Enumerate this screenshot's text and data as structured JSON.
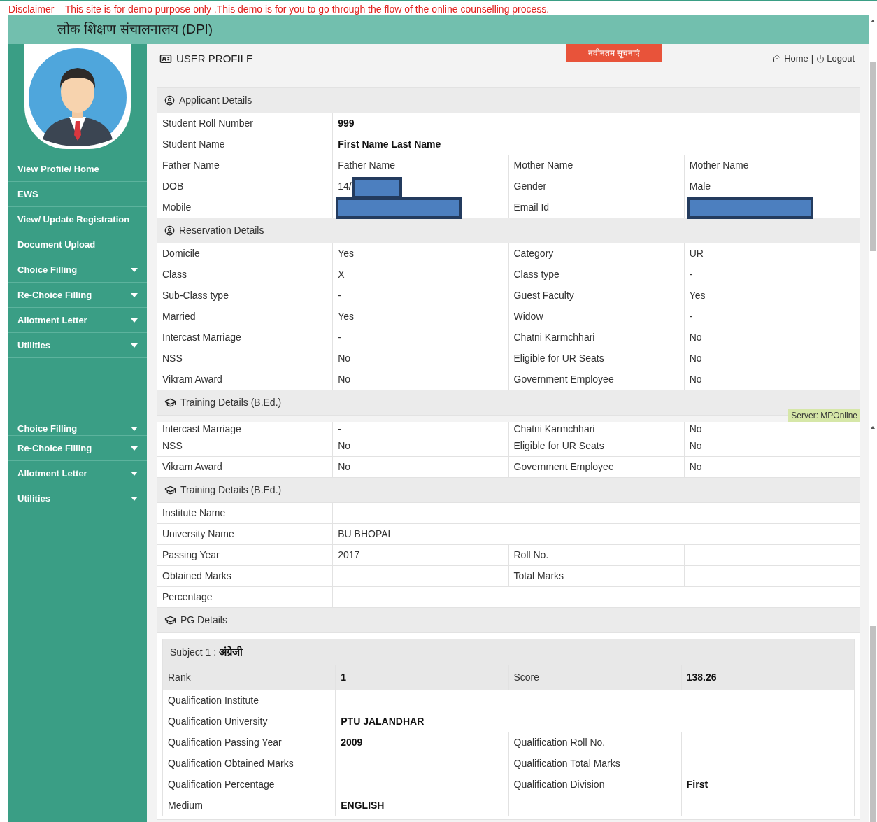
{
  "disclaimer": "Disclaimer – This site is for demo purpose only .This demo is for you to go through the flow of the online counselling process.",
  "header": {
    "title": "लोक शिक्षण संचालनालय (DPI)"
  },
  "top_view": {
    "sidebar_items": [
      {
        "label": "View Profile/ Home",
        "dropdown": false
      },
      {
        "label": "EWS",
        "dropdown": false
      },
      {
        "label": "View/ Update Registration",
        "dropdown": false
      },
      {
        "label": "Document Upload",
        "dropdown": false
      },
      {
        "label": "Choice Filling",
        "dropdown": true
      },
      {
        "label": "Re-Choice Filling",
        "dropdown": true
      },
      {
        "label": "Allotment Letter",
        "dropdown": true
      },
      {
        "label": "Utilities",
        "dropdown": true
      }
    ],
    "page_title": "USER PROFILE",
    "notice_button": "नवीनतम सूचनाएं",
    "nav": {
      "home": "Home",
      "separator": "|",
      "logout": "Logout"
    },
    "sections": [
      {
        "title": "Applicant Details",
        "kind": "user",
        "rows": [
          {
            "cells": [
              {
                "text": "Student Roll Number"
              },
              {
                "text": "999",
                "bold": true,
                "wide": true
              }
            ]
          },
          {
            "cells": [
              {
                "text": "Student Name"
              },
              {
                "text": "First Name Last Name",
                "bold": true,
                "wide": true
              }
            ]
          },
          {
            "cells": [
              {
                "text": "Father Name"
              },
              {
                "text": "Father Name"
              },
              {
                "text": "Mother Name"
              },
              {
                "text": "Mother Name"
              }
            ]
          },
          {
            "cells": [
              {
                "text": "DOB"
              },
              {
                "text": "14/",
                "redacted": true
              },
              {
                "text": "Gender"
              },
              {
                "text": "Male"
              }
            ]
          },
          {
            "cells": [
              {
                "text": "Mobile"
              },
              {
                "redacted": true
              },
              {
                "text": "Email Id"
              },
              {
                "redacted": true
              }
            ]
          }
        ]
      },
      {
        "title": "Reservation Details",
        "kind": "user",
        "rows": [
          {
            "cells": [
              {
                "text": "Domicile"
              },
              {
                "text": "Yes"
              },
              {
                "text": "Category"
              },
              {
                "text": "UR"
              }
            ]
          },
          {
            "cells": [
              {
                "text": "Class"
              },
              {
                "text": "X"
              },
              {
                "text": "Class type"
              },
              {
                "text": "-"
              }
            ]
          },
          {
            "cells": [
              {
                "text": "Sub-Class type"
              },
              {
                "text": "-"
              },
              {
                "text": "Guest Faculty"
              },
              {
                "text": "Yes"
              }
            ]
          },
          {
            "cells": [
              {
                "text": "Married"
              },
              {
                "text": "Yes"
              },
              {
                "text": "Widow"
              },
              {
                "text": "-"
              }
            ]
          },
          {
            "cells": [
              {
                "text": "Intercast Marriage"
              },
              {
                "text": "-"
              },
              {
                "text": "Chatni Karmchhari"
              },
              {
                "text": "No"
              }
            ]
          },
          {
            "cells": [
              {
                "text": "NSS"
              },
              {
                "text": "No"
              },
              {
                "text": "Eligible for UR Seats"
              },
              {
                "text": "No"
              }
            ]
          },
          {
            "cells": [
              {
                "text": "Vikram Award"
              },
              {
                "text": "No"
              },
              {
                "text": "Government Employee"
              },
              {
                "text": "No"
              }
            ]
          }
        ]
      },
      {
        "title": "Training Details (B.Ed.)",
        "kind": "cap"
      }
    ],
    "server_label": "Server: MPOnline"
  },
  "bottom_view": {
    "sidebar_items": [
      {
        "label": "Choice Filling",
        "dropdown": true,
        "clipped": true
      },
      {
        "label": "Re-Choice Filling",
        "dropdown": true,
        "clipped": false
      },
      {
        "label": "Allotment Letter",
        "dropdown": true,
        "clipped": false
      },
      {
        "label": "Utilities",
        "dropdown": true,
        "clipped": false
      }
    ],
    "sections": [
      {
        "rows": [
          {
            "clipped": true,
            "cells": [
              {
                "text": "Intercast Marriage"
              },
              {
                "text": "-"
              },
              {
                "text": "Chatni Karmchhari"
              },
              {
                "text": "No"
              }
            ]
          },
          {
            "cells": [
              {
                "text": "NSS"
              },
              {
                "text": "No"
              },
              {
                "text": "Eligible for UR Seats"
              },
              {
                "text": "No"
              }
            ]
          },
          {
            "cells": [
              {
                "text": "Vikram Award"
              },
              {
                "text": "No"
              },
              {
                "text": "Government Employee"
              },
              {
                "text": "No"
              }
            ]
          }
        ]
      },
      {
        "title": "Training Details (B.Ed.)",
        "kind": "cap",
        "rows": [
          {
            "cells": [
              {
                "text": "Institute Name"
              },
              {
                "wide": true
              }
            ]
          },
          {
            "cells": [
              {
                "text": "University Name"
              },
              {
                "text": "BU BHOPAL",
                "wide": true
              }
            ]
          },
          {
            "cells": [
              {
                "text": "Passing Year"
              },
              {
                "text": "2017"
              },
              {
                "text": "Roll No."
              },
              {}
            ]
          },
          {
            "cells": [
              {
                "text": "Obtained Marks"
              },
              {},
              {
                "text": "Total Marks"
              },
              {}
            ]
          },
          {
            "cells": [
              {
                "text": "Percentage"
              },
              {
                "wide": true
              }
            ]
          }
        ]
      },
      {
        "title": "PG Details",
        "kind": "cap"
      }
    ],
    "subject": {
      "label": "Subject 1 : ",
      "name": "अंग्रेजी",
      "rows": [
        {
          "shaded": true,
          "cells": [
            {
              "text": "Rank"
            },
            {
              "text": "1",
              "bold": true
            },
            {
              "text": "Score"
            },
            {
              "text": "138.26",
              "bold": true
            }
          ]
        },
        {
          "shaded": false,
          "cells": [
            {
              "text": "Qualification Institute"
            },
            {
              "wide": true
            }
          ]
        },
        {
          "shaded": false,
          "cells": [
            {
              "text": "Qualification University"
            },
            {
              "text": "PTU JALANDHAR",
              "bold": true,
              "wide": true
            }
          ]
        },
        {
          "shaded": false,
          "cells": [
            {
              "text": "Qualification Passing Year"
            },
            {
              "text": "2009",
              "bold": true
            },
            {
              "text": "Qualification Roll No."
            },
            {}
          ]
        },
        {
          "shaded": false,
          "cells": [
            {
              "text": "Qualification Obtained Marks"
            },
            {},
            {
              "text": "Qualification Total Marks"
            },
            {}
          ]
        },
        {
          "shaded": false,
          "cells": [
            {
              "text": "Qualification Percentage"
            },
            {},
            {
              "text": "Qualification Division"
            },
            {
              "text": "First",
              "bold": true
            }
          ]
        },
        {
          "shaded": false,
          "cells": [
            {
              "text": "Medium"
            },
            {
              "text": "ENGLISH",
              "bold": true
            },
            {},
            {}
          ]
        }
      ]
    }
  }
}
